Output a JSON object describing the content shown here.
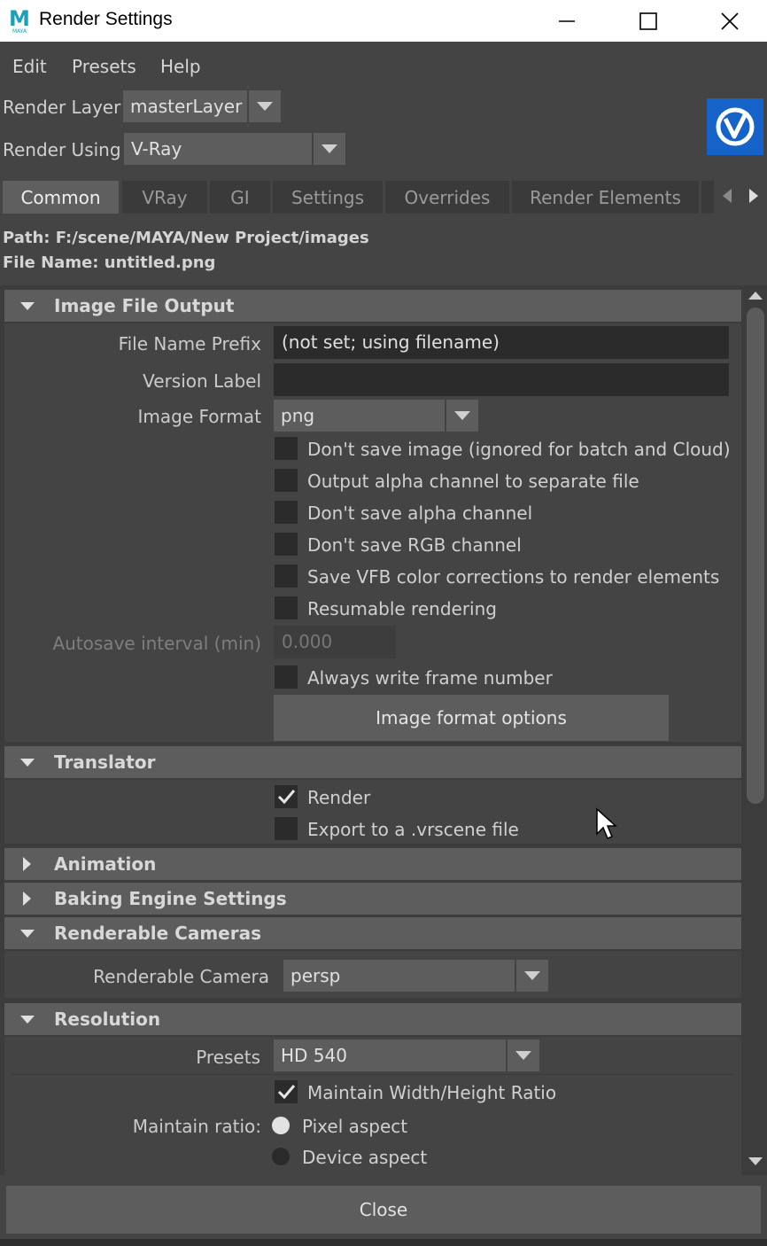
{
  "window": {
    "title": "Render Settings",
    "app_icon": "maya-icon",
    "app_icon_letter": "M",
    "app_icon_sub": "MAYA"
  },
  "menu": [
    "Edit",
    "Presets",
    "Help"
  ],
  "render_layer": {
    "label": "Render Layer",
    "value": "masterLayer"
  },
  "render_using": {
    "label": "Render Using",
    "value": "V-Ray"
  },
  "tabs": [
    "Common",
    "VRay",
    "GI",
    "Settings",
    "Overrides",
    "Render Elements"
  ],
  "active_tab": "Common",
  "path_line": "Path: F:/scene/MAYA/New Project/images",
  "filename_line": "File Name: untitled.png",
  "sections": {
    "image_file_output": {
      "title": "Image File Output",
      "file_name_prefix_label": "File Name Prefix",
      "file_name_prefix_value": "(not set; using filename)",
      "version_label_label": "Version Label",
      "version_label_value": "",
      "image_format_label": "Image Format",
      "image_format_value": "png",
      "checkboxes": [
        {
          "label": "Don't save image (ignored for batch and Cloud)",
          "checked": false
        },
        {
          "label": "Output alpha channel to separate file",
          "checked": false
        },
        {
          "label": "Don't save alpha channel",
          "checked": false
        },
        {
          "label": "Don't save RGB channel",
          "checked": false
        },
        {
          "label": "Save VFB color corrections to render elements",
          "checked": false
        },
        {
          "label": "Resumable rendering",
          "checked": false
        }
      ],
      "autosave_label": "Autosave interval (min)",
      "autosave_value": "0.000",
      "always_write_label": "Always write frame number",
      "image_format_options_button": "Image format options"
    },
    "translator": {
      "title": "Translator",
      "render_label": "Render",
      "render_checked": true,
      "export_label": "Export to a .vrscene file",
      "export_checked": false
    },
    "animation": {
      "title": "Animation"
    },
    "baking": {
      "title": "Baking Engine Settings"
    },
    "renderable_cameras": {
      "title": "Renderable Cameras",
      "camera_label": "Renderable Camera",
      "camera_value": "persp"
    },
    "resolution": {
      "title": "Resolution",
      "presets_label": "Presets",
      "presets_value": "HD 540",
      "maintain_wh_label": "Maintain Width/Height Ratio",
      "maintain_wh_checked": true,
      "maintain_ratio_label": "Maintain ratio:",
      "pixel_aspect_label": "Pixel aspect",
      "device_aspect_label": "Device aspect",
      "selected_ratio": "Pixel aspect"
    }
  },
  "close_button": "Close",
  "colors": {
    "window_bg": "#444444",
    "panel_bg": "#3c3c3c",
    "section_header": "#5d5d5d",
    "field_bg": "#2b2b2b",
    "vray_blue": "#1563c8",
    "maya_teal": "#1aa0b8"
  }
}
